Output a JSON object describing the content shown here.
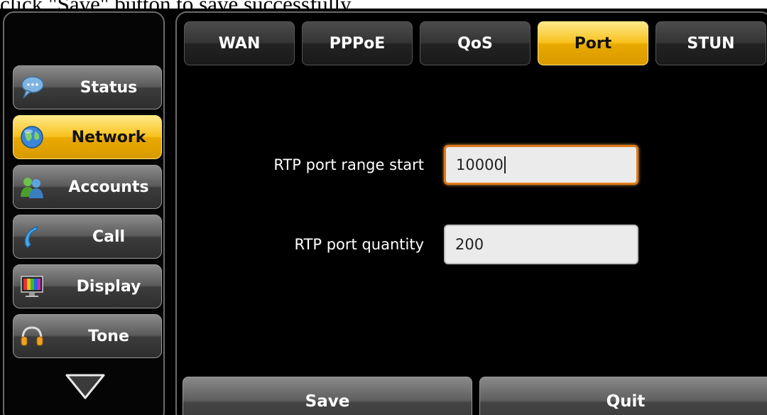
{
  "caption": "click \"Save\" button to save successfully.",
  "sidebar": {
    "items": [
      {
        "label": "Status",
        "icon": "chat-bubble-icon",
        "active": false
      },
      {
        "label": "Network",
        "icon": "globe-icon",
        "active": true
      },
      {
        "label": "Accounts",
        "icon": "users-icon",
        "active": false
      },
      {
        "label": "Call",
        "icon": "handset-icon",
        "active": false
      },
      {
        "label": "Display",
        "icon": "monitor-icon",
        "active": false
      },
      {
        "label": "Tone",
        "icon": "headphones-icon",
        "active": false
      }
    ],
    "more_icon": "triangle-down-icon"
  },
  "tabs": [
    {
      "label": "WAN",
      "active": false
    },
    {
      "label": "PPPoE",
      "active": false
    },
    {
      "label": "QoS",
      "active": false
    },
    {
      "label": "Port",
      "active": true
    },
    {
      "label": "STUN",
      "active": false
    }
  ],
  "form": {
    "rtp_start": {
      "label": "RTP port range start",
      "value": "10000"
    },
    "rtp_quantity": {
      "label": "RTP port quantity",
      "value": "200"
    }
  },
  "actions": {
    "save_label": "Save",
    "quit_label": "Quit"
  },
  "colors": {
    "accent": "#f7c21e",
    "focus_border": "#e07a1a",
    "background": "#000000"
  }
}
